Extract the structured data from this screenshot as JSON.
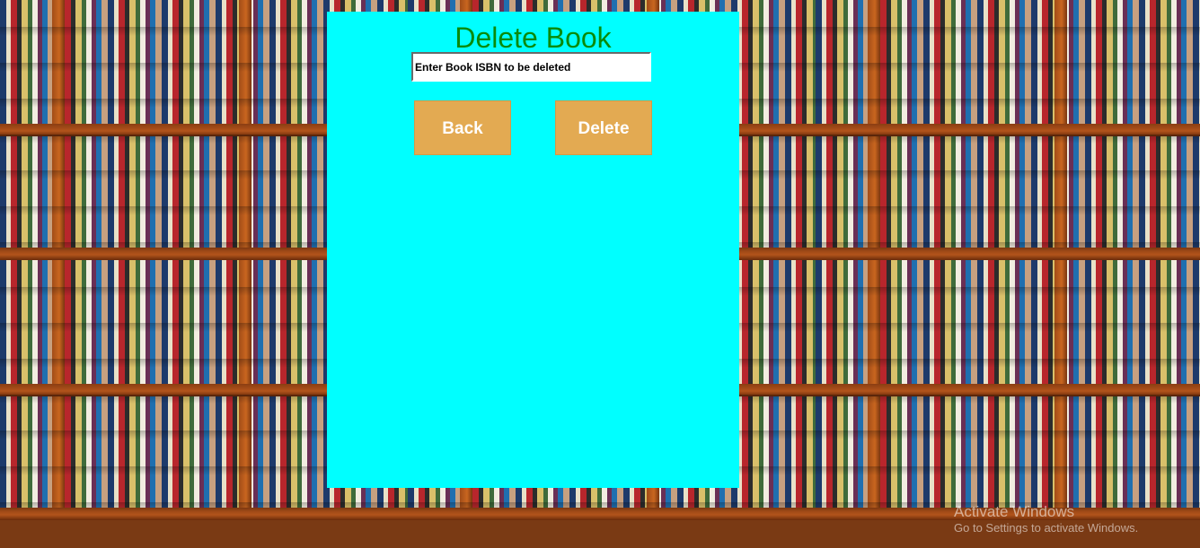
{
  "window": {
    "title": "Delete Book"
  },
  "form": {
    "isbn_value": "Enter Book ISBN to be deleted"
  },
  "buttons": {
    "back_label": "Back",
    "delete_label": "Delete"
  },
  "watermark": {
    "title": "Activate Windows",
    "subtitle": "Go to Settings to activate Windows."
  },
  "colors": {
    "panel_bg": "#00ffff",
    "title_color": "#0a8a0a",
    "button_bg": "#e3aa52",
    "button_text": "#ffffff"
  },
  "background": {
    "image": "bookshelf-background"
  }
}
